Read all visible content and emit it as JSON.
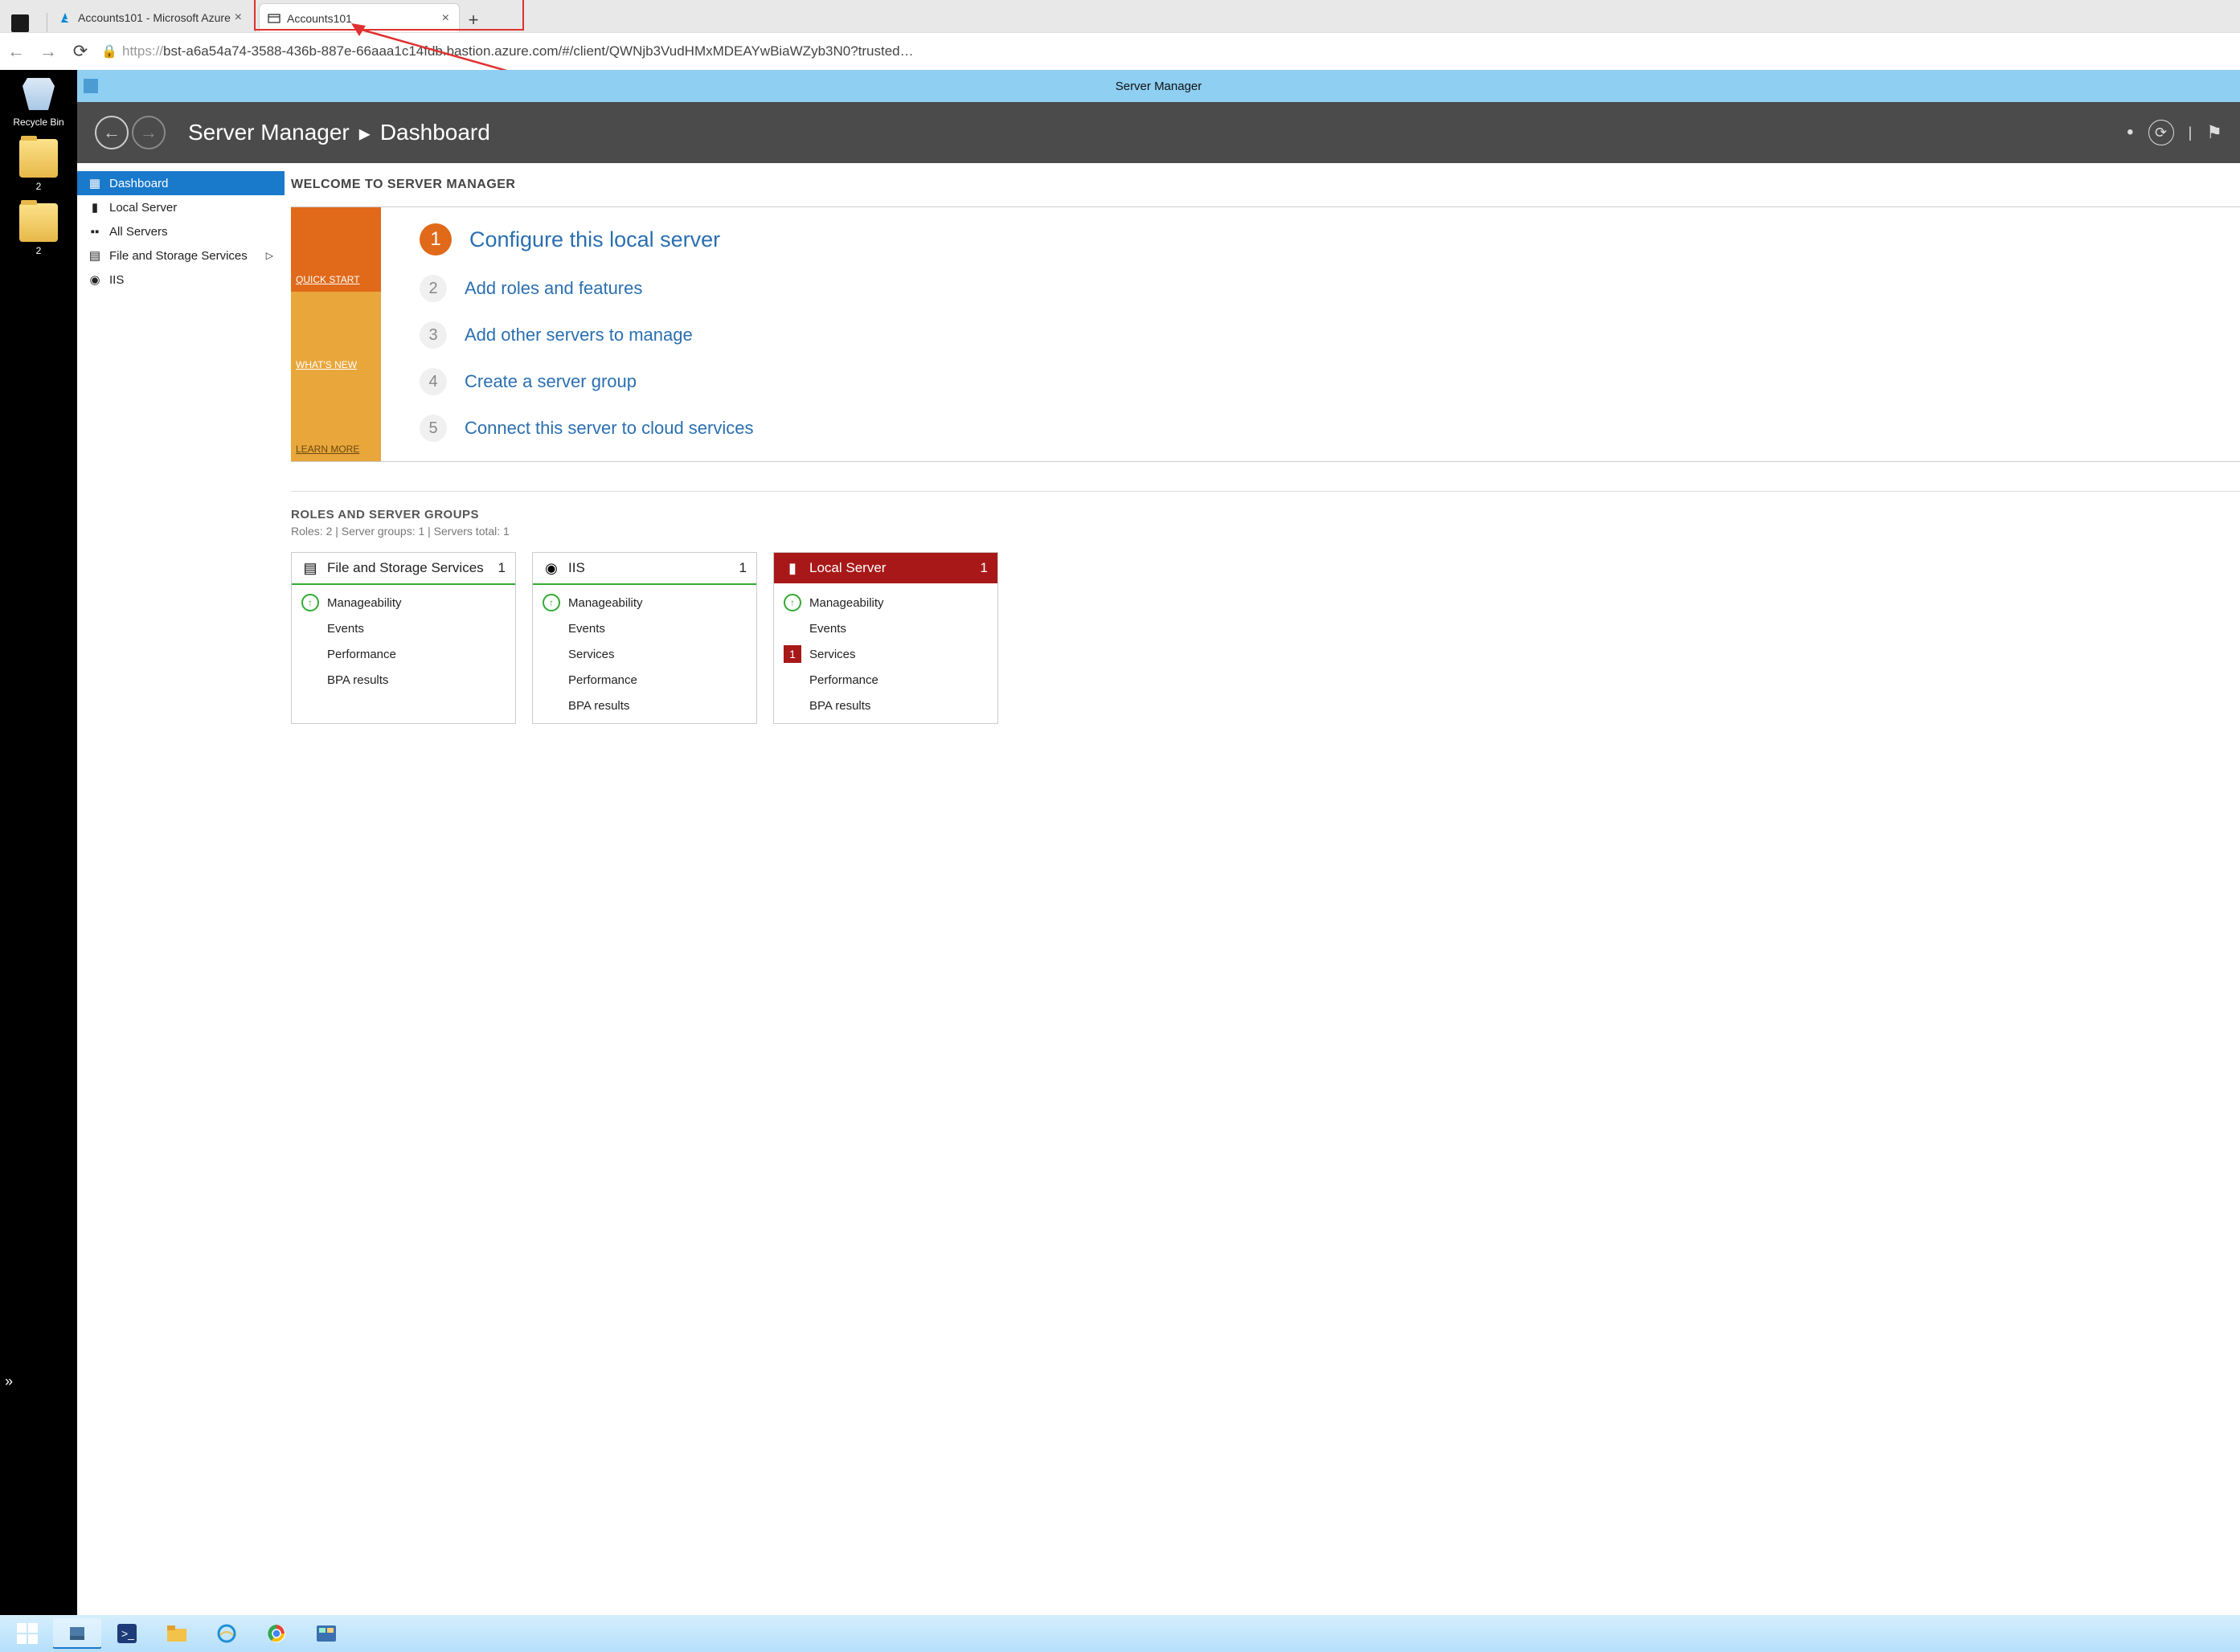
{
  "browser": {
    "tabs": [
      {
        "title": "Accounts101 - Microsoft Azure",
        "favicon": "azure-icon"
      },
      {
        "title": "Accounts101",
        "favicon": "window-icon"
      }
    ],
    "url_proto": "https://",
    "url_rest": "bst-a6a54a74-3588-436b-887e-66aaa1c14fdb.bastion.azure.com/#/client/QWNjb3VudHMxMDEAYwBiaWZyb3N0?trusted…",
    "new_tab_label": "+"
  },
  "desktop": {
    "recycle_label": "Recycle Bin",
    "folder1_label": "2",
    "folder2_label": "2"
  },
  "sm": {
    "window_title": "Server Manager",
    "breadcrumb_app": "Server Manager",
    "breadcrumb_page": "Dashboard",
    "nav": {
      "dashboard": "Dashboard",
      "local": "Local Server",
      "all": "All Servers",
      "file": "File and Storage Services",
      "iis": "IIS"
    },
    "welcome": {
      "title": "WELCOME TO SERVER MANAGER",
      "side": {
        "quick": "QUICK START",
        "whats": "WHAT'S NEW",
        "learn": "LEARN MORE"
      },
      "steps": [
        {
          "n": "1",
          "txt": "Configure this local server"
        },
        {
          "n": "2",
          "txt": "Add roles and features"
        },
        {
          "n": "3",
          "txt": "Add other servers to manage"
        },
        {
          "n": "4",
          "txt": "Create a server group"
        },
        {
          "n": "5",
          "txt": "Connect this server to cloud services"
        }
      ]
    },
    "roles": {
      "title": "ROLES AND SERVER GROUPS",
      "sub": "Roles: 2  |  Server groups: 1  |  Servers total: 1",
      "tiles": [
        {
          "name": "File and Storage Services",
          "count": "1",
          "items": [
            "Manageability",
            "Events",
            "Performance",
            "BPA results"
          ]
        },
        {
          "name": "IIS",
          "count": "1",
          "items": [
            "Manageability",
            "Events",
            "Services",
            "Performance",
            "BPA results"
          ]
        },
        {
          "name": "Local Server",
          "count": "1",
          "items": [
            "Manageability",
            "Events",
            "Services",
            "Performance",
            "BPA results"
          ],
          "alert_index": 2,
          "alert_badge": "1"
        }
      ]
    }
  }
}
